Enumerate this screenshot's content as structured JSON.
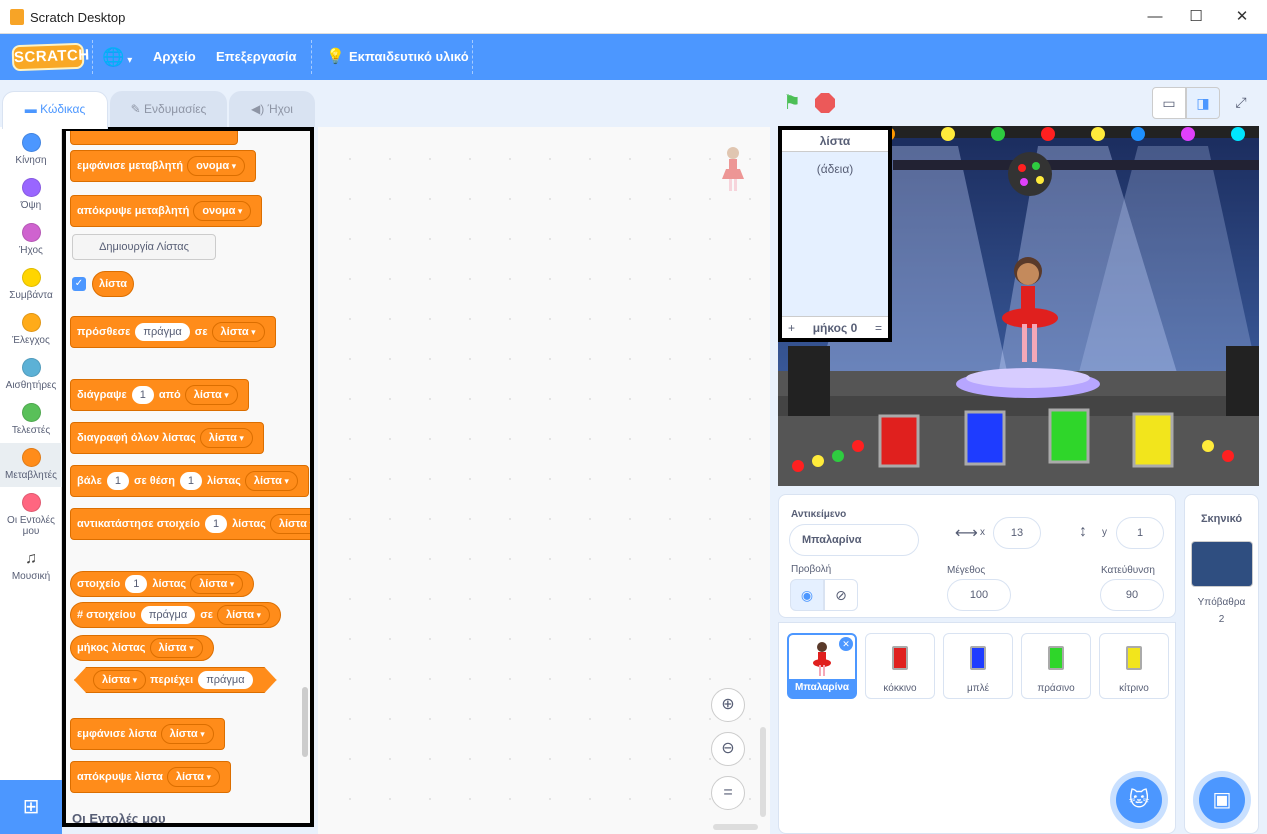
{
  "window": {
    "title": "Scratch Desktop"
  },
  "menubar": {
    "logo": "SCRATCH",
    "file": "Αρχείο",
    "edit": "Επεξεργασία",
    "tutorials": "Εκπαιδευτικό υλικό"
  },
  "tabs": {
    "code": "Κώδικας",
    "costumes": "Ενδυμασίες",
    "sounds": "Ήχοι"
  },
  "categories": [
    {
      "label": "Κίνηση",
      "color": "#4c97ff"
    },
    {
      "label": "Όψη",
      "color": "#9966ff"
    },
    {
      "label": "Ήχος",
      "color": "#cf63cf"
    },
    {
      "label": "Συμβάντα",
      "color": "#ffd500"
    },
    {
      "label": "Έλεγχος",
      "color": "#ffab19"
    },
    {
      "label": "Αισθητήρες",
      "color": "#5cb1d6"
    },
    {
      "label": "Τελεστές",
      "color": "#59c059"
    },
    {
      "label": "Μεταβλητές",
      "color": "#ff8c1a"
    },
    {
      "label": "Οι Εντολές μου",
      "color": "#ff6680"
    },
    {
      "label": "Μουσική",
      "color": ""
    }
  ],
  "palette": {
    "show_variable": "εμφάνισε μεταβλητή",
    "hide_variable": "απόκρυψε μεταβλητή",
    "variable_name": "ονομα",
    "make_list": "Δημιουργία Λίστας",
    "list_name": "λίστα",
    "add_to": "πρόσθεσε",
    "thing": "πράγμα",
    "to": "σε",
    "delete": "διάγραψε",
    "one": "1",
    "of": "από",
    "delete_all": "διαγραφή όλων λίστας",
    "insert": "βάλε",
    "at_position": "σε θέση",
    "of_list": "λίστας",
    "replace_item": "αντικατάστησε στοιχείο",
    "item": "στοιχείο",
    "item_num": "# στοιχείου",
    "length": "μήκος λίστας",
    "contains": "περιέχει",
    "show_list": "εμφάνισε λίστα",
    "hide_list": "απόκρυψε λίστα",
    "my_blocks": "Οι Εντολές μου"
  },
  "list_monitor": {
    "title": "λίστα",
    "empty": "(άδεια)",
    "add": "+",
    "length": "μήκος 0",
    "resize": "="
  },
  "sprite_info": {
    "sprite_label": "Αντικείμενο",
    "sprite_name": "Μπαλαρίνα",
    "x_label": "x",
    "x": "13",
    "y_label": "y",
    "y": "1",
    "show_label": "Προβολή",
    "size_label": "Μέγεθος",
    "size": "100",
    "direction_label": "Κατεύθυνση",
    "direction": "90"
  },
  "sprites": [
    {
      "name": "Μπαλαρίνα",
      "color": "#e0201e"
    },
    {
      "name": "κόκκινο",
      "color": "#e0201e"
    },
    {
      "name": "μπλέ",
      "color": "#1e3cff"
    },
    {
      "name": "πράσινο",
      "color": "#2fd62a"
    },
    {
      "name": "κίτρινο",
      "color": "#f2e51c"
    }
  ],
  "stage_panel": {
    "title": "Σκηνικό",
    "backdrops_label": "Υπόβαθρα",
    "backdrops_count": "2"
  }
}
